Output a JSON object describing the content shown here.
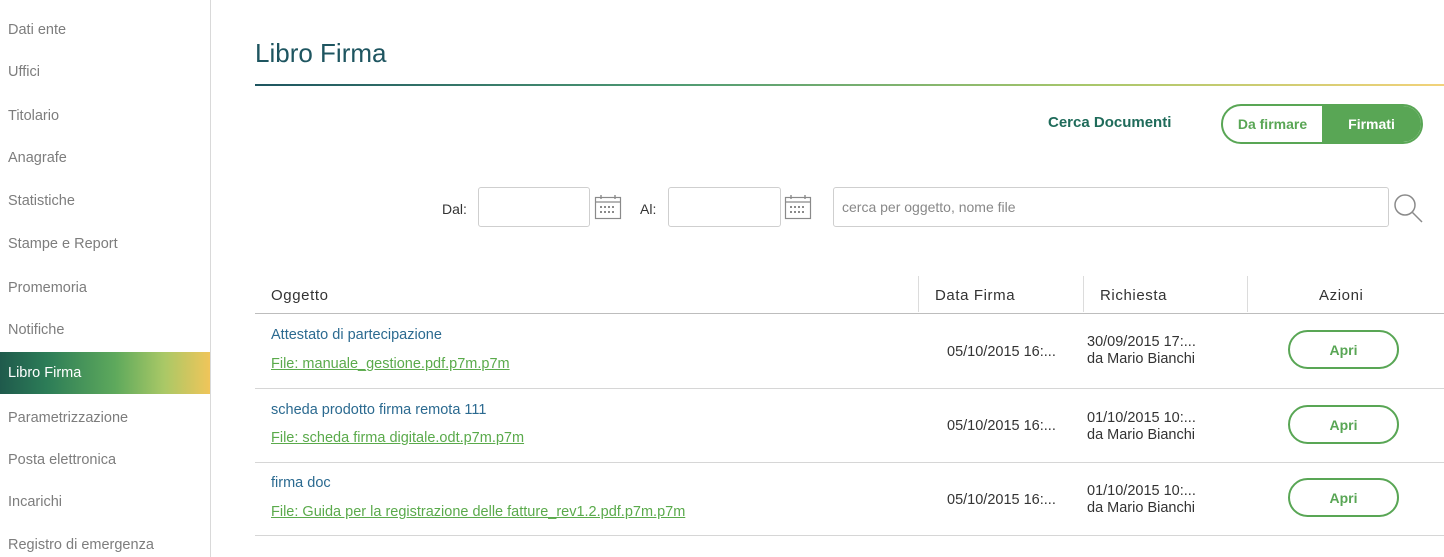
{
  "sidebar": {
    "items": [
      {
        "label": "Dati ente"
      },
      {
        "label": "Uffici"
      },
      {
        "label": "Titolario"
      },
      {
        "label": "Anagrafe"
      },
      {
        "label": "Statistiche"
      },
      {
        "label": "Stampe e Report"
      },
      {
        "label": "Promemoria"
      },
      {
        "label": "Notifiche"
      },
      {
        "label": "Libro Firma",
        "active": true
      },
      {
        "label": "Parametrizzazione"
      },
      {
        "label": "Posta elettronica"
      },
      {
        "label": "Incarichi"
      },
      {
        "label": "Registro di emergenza"
      }
    ]
  },
  "main": {
    "title": "Libro Firma",
    "search_label": "Cerca Documenti",
    "toggle": {
      "option_1": "Da firmare",
      "option_2": "Firmati",
      "selected": "Firmati"
    },
    "filters": {
      "from_label": "Dal:",
      "to_label": "Al:",
      "search_placeholder": "cerca per oggetto, nome file"
    },
    "table": {
      "headers": {
        "subject": "Oggetto",
        "sign_date": "Data Firma",
        "request": "Richiesta",
        "actions": "Azioni"
      },
      "rows": [
        {
          "subject": "Attestato di partecipazione",
          "file": "File: manuale_gestione.pdf.p7m.p7m",
          "sign_date": "05/10/2015 16:...",
          "request_date": "30/09/2015 17:...",
          "request_by": "da Mario Bianchi",
          "action": "Apri"
        },
        {
          "subject": "scheda prodotto firma remota 111",
          "file": "File: scheda firma digitale.odt.p7m.p7m",
          "sign_date": "05/10/2015 16:...",
          "request_date": "01/10/2015 10:...",
          "request_by": "da Mario Bianchi",
          "action": "Apri"
        },
        {
          "subject": "firma doc",
          "file": "File: Guida per la registrazione delle fatture_rev1.2.pdf.p7m.p7m",
          "sign_date": "05/10/2015 16:...",
          "request_date": "01/10/2015 10:...",
          "request_by": "da Mario Bianchi",
          "action": "Apri"
        }
      ]
    }
  },
  "colors": {
    "accent_green": "#59a655",
    "title_teal": "#1e5560",
    "link_blue": "#2b6a90"
  }
}
